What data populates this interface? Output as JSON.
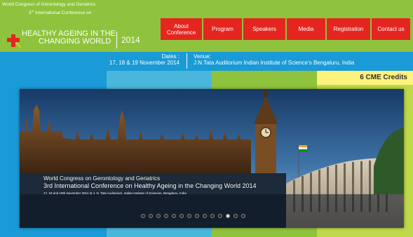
{
  "logo": {
    "line1": "World Congress of Gerontology and Geriatrics",
    "line2_ordinal": "3",
    "line2_suffix": "rd",
    "line2_text": "International Conference on",
    "main1": "HEALTHY AGEING IN THE",
    "main2": "CHANGING WORLD",
    "year": "2014"
  },
  "nav": {
    "items": [
      {
        "label": "About Conference"
      },
      {
        "label": "Program"
      },
      {
        "label": "Speakers"
      },
      {
        "label": "Media"
      },
      {
        "label": "Registration"
      },
      {
        "label": "Contact us"
      }
    ]
  },
  "info": {
    "dates_label": "Dates :",
    "dates_value": "17, 18 & 19 November 2014",
    "venue_label": "Venue:",
    "venue_value": "J.N.Tata Auditorium Indian Institute of Science's Bengaluru, India"
  },
  "cme": {
    "label": "6 CME Credits"
  },
  "banner": {
    "caption1": "World Congress on Gerontology and Geriatrics",
    "caption2": "3rd International Conference on Healthy Ageing in the Changing World 2014",
    "caption3": "17, 18 and 19th November 2014 at J. N. Tata Auditorium, Indian Institute of Sciences, Bengaluru, India",
    "slide_count": 14,
    "active_slide": 12
  },
  "colors": {
    "header_green": "#8fc33d",
    "nav_red": "#e52620",
    "info_blue": "#1a9ad6",
    "cme_yellow": "#fdf27c"
  }
}
